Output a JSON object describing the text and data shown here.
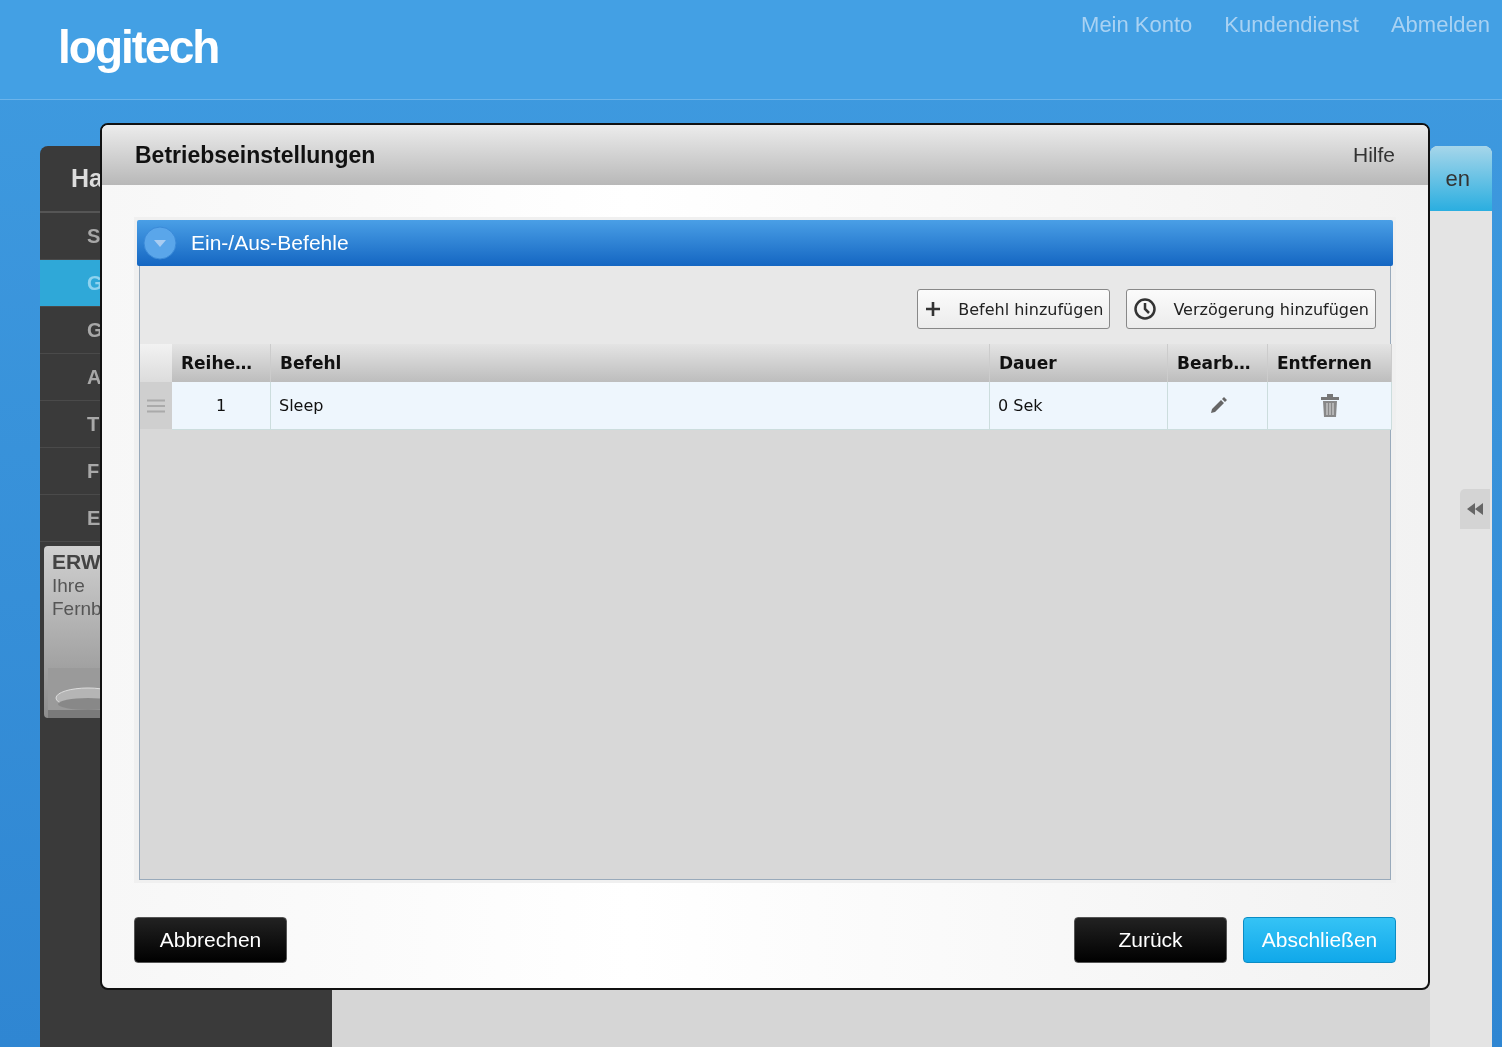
{
  "header": {
    "logo": "logitech",
    "links": [
      "Mein Konto",
      "Kundendienst",
      "Abmelden"
    ]
  },
  "sidebar": {
    "title": "Ha",
    "items": [
      {
        "label": "S",
        "selected": false
      },
      {
        "label": "G",
        "selected": true
      },
      {
        "label": "G",
        "selected": false
      },
      {
        "label": "A",
        "selected": false
      },
      {
        "label": "T",
        "selected": false
      },
      {
        "label": "F",
        "selected": false
      },
      {
        "label": "E",
        "selected": false
      }
    ],
    "promo": {
      "title": "ERW",
      "lines": [
        "Ihre",
        "Fernb"
      ],
      "kind": "picture"
    }
  },
  "right_panel": {
    "title": "en"
  },
  "dialog": {
    "title": "Betriebseinstellungen",
    "help": "Hilfe",
    "section": {
      "title": "Ein-/Aus-Befehle",
      "expanded": true,
      "actions": [
        {
          "label": "Befehl hinzufügen",
          "kind": "add"
        },
        {
          "label": "Verzögerung hinzufügen",
          "kind": "delay"
        }
      ],
      "table": {
        "columns": [
          "Reihe…",
          "Befehl",
          "Dauer",
          "Bearb…",
          "Entfernen"
        ],
        "rows": [
          {
            "order": "1",
            "command": "Sleep",
            "duration": "0 Sek"
          }
        ]
      }
    },
    "buttons": [
      {
        "label": "Abbrechen",
        "kind": "secondary"
      },
      {
        "label": "Zurück",
        "kind": "secondary"
      },
      {
        "label": "Abschließen",
        "kind": "primary"
      }
    ]
  }
}
